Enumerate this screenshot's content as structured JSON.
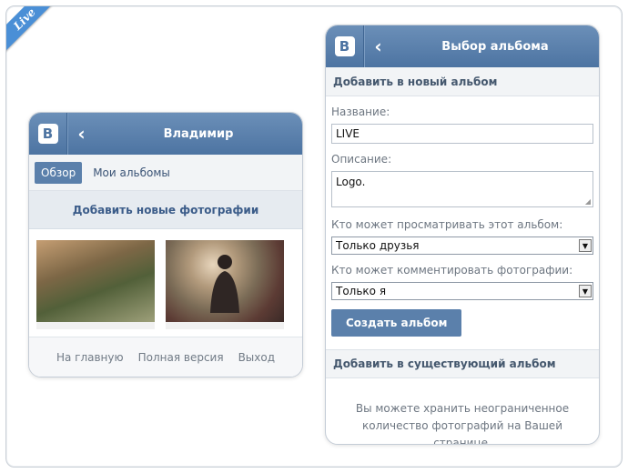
{
  "badge": "Live",
  "left_phone": {
    "title": "Владимир",
    "logo": "В",
    "tabs": [
      "Обзор",
      "Мои альбомы"
    ],
    "add_photos": "Добавить новые фотографии",
    "footer": [
      "На главную",
      "Полная версия",
      "Выход"
    ]
  },
  "right_phone": {
    "title": "Выбор альбома",
    "logo": "В",
    "section_new": "Добавить в новый альбом",
    "name_label": "Название:",
    "name_value": "LIVE",
    "desc_label": "Описание:",
    "desc_value": "Logo.",
    "view_label": "Кто может просматривать этот альбом:",
    "view_value": "Только друзья",
    "comment_label": "Кто может комментировать фотографии:",
    "comment_value": "Только я",
    "create_button": "Создать альбом",
    "section_existing": "Добавить в существующий альбом",
    "note": "Вы можете хранить неограниченное количество фотографий на Вашей странице."
  },
  "colors": {
    "header": "#5a7ea9",
    "accent": "#5b80ab",
    "ribbon": "#4a8fd6"
  },
  "icons": {
    "back": "chevron-left-icon",
    "dropdown": "triangle-down-icon"
  }
}
